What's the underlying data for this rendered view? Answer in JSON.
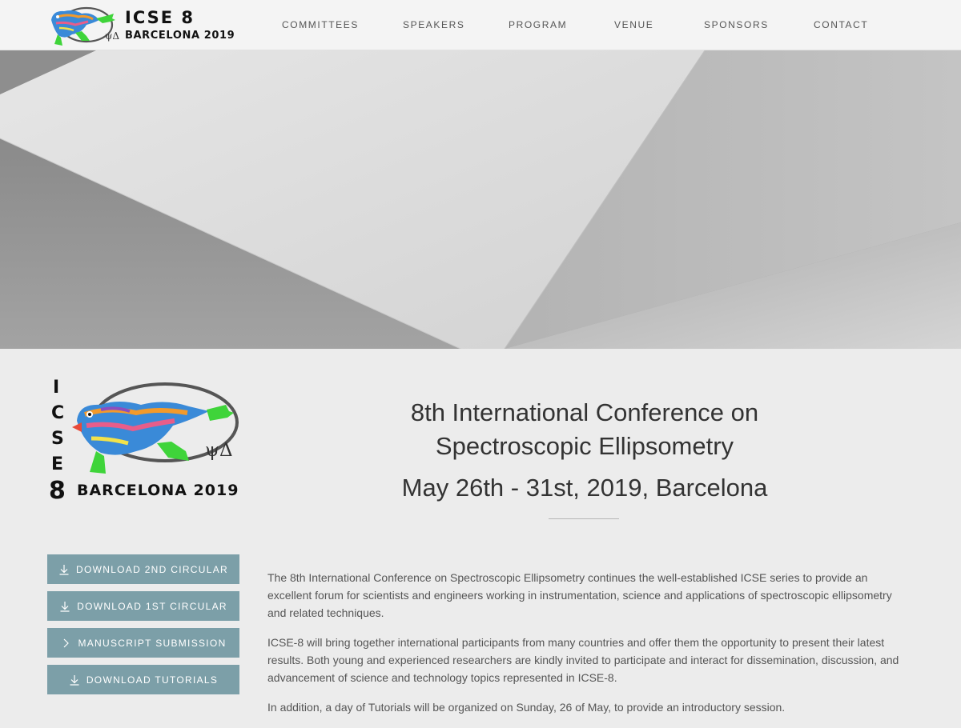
{
  "header": {
    "logo": {
      "title": "ICSE 8",
      "subtitle": "BARCELONA 2019",
      "symbol": "ψΔ"
    },
    "nav": [
      {
        "label": "COMMITTEES"
      },
      {
        "label": "SPEAKERS"
      },
      {
        "label": "PROGRAM"
      },
      {
        "label": "VENUE"
      },
      {
        "label": "SPONSORS"
      },
      {
        "label": "CONTACT"
      }
    ]
  },
  "hero": {
    "image": "abstract-grey-paper-planes"
  },
  "intro_logo": {
    "letters": [
      "I",
      "C",
      "S",
      "E",
      "8"
    ],
    "city_year": "BARCELONA 2019",
    "symbol": "ψΔ"
  },
  "conference": {
    "title_line1": "8th International Conference on",
    "title_line2": "Spectroscopic Ellipsometry",
    "dates": "May 26th - 31st, 2019, Barcelona"
  },
  "buttons": [
    {
      "label": "DOWNLOAD 2ND CIRCULAR",
      "icon": "download-icon"
    },
    {
      "label": "DOWNLOAD 1ST CIRCULAR",
      "icon": "download-icon"
    },
    {
      "label": "MANUSCRIPT SUBMISSION",
      "icon": "chevron-right-icon"
    },
    {
      "label": "DOWNLOAD TUTORIALS",
      "icon": "download-icon"
    }
  ],
  "body": {
    "paragraphs": [
      "The 8th International Conference on Spectroscopic Ellipsometry continues the well-established ICSE series to provide an excellent forum for scientists and engineers working in instrumentation, science and applications of spectroscopic ellipsometry and related techniques.",
      "ICSE-8 will bring together international participants from many countries and offer them the opportunity to present their latest results. Both young and experienced researchers are kindly invited to participate and interact for dissemination, discussion, and advancement of science and technology topics represented in ICSE-8.",
      "In addition, a day of Tutorials will be organized on Sunday, 26 of May, to provide an introductory session."
    ]
  },
  "colors": {
    "button_bg": "#7c9fa8",
    "page_bg": "#ececec",
    "header_bg": "#f4f4f4"
  }
}
